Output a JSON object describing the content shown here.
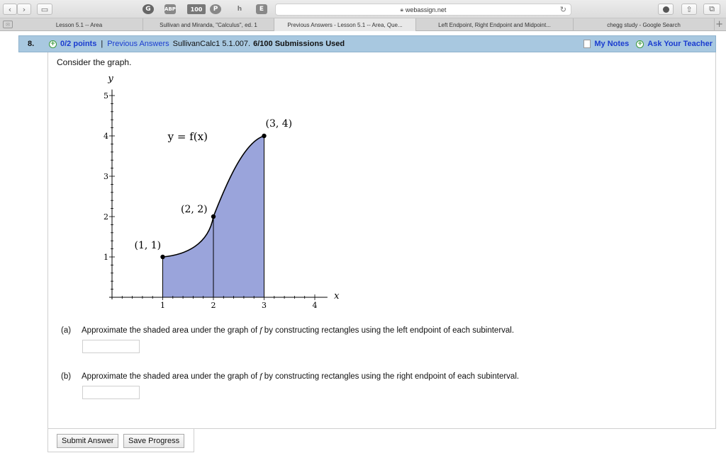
{
  "browser": {
    "url": "webassign.net",
    "extension_badge": "100",
    "tabs": [
      "Lesson 5.1 -- Area",
      "Sullivan and Miranda, \"Calculus\", ed. 1",
      "Previous Answers - Lesson 5.1 -- Area, Que...",
      "Left Endpoint, Right Endpoint and Midpoint...",
      "chegg study - Google Search"
    ]
  },
  "question": {
    "number": "8.",
    "points": "0/2 points",
    "separator": "|",
    "previous_answers": "Previous Answers",
    "source": "SullivanCalc1 5.1.007.",
    "submissions": "6/100 Submissions Used",
    "my_notes": "My Notes",
    "ask_teacher": "Ask Your Teacher",
    "prompt": "Consider the graph."
  },
  "graph": {
    "curve_label": "y = f(x)",
    "axis_x_label": "x",
    "axis_y_label": "y",
    "x_ticks": [
      "1",
      "2",
      "3",
      "4"
    ],
    "y_ticks": [
      "1",
      "2",
      "3",
      "4",
      "5"
    ],
    "points": [
      {
        "label": "(1, 1)",
        "x": 1,
        "y": 1
      },
      {
        "label": "(2, 2)",
        "x": 2,
        "y": 2
      },
      {
        "label": "(3, 4)",
        "x": 3,
        "y": 4
      }
    ],
    "shaded_interval": [
      1,
      3
    ],
    "colors": {
      "fill": "#9aa4db",
      "curve": "#000000"
    }
  },
  "parts": [
    {
      "label": "(a)",
      "before": "Approximate the shaded area under the graph of ",
      "var": "f",
      "after": " by constructing rectangles using the left endpoint of each subinterval.",
      "value": ""
    },
    {
      "label": "(b)",
      "before": "Approximate the shaded area under the graph of ",
      "var": "f",
      "after": " by constructing rectangles using the right endpoint of each subinterval.",
      "value": ""
    }
  ],
  "buttons": {
    "submit": "Submit Answer",
    "save": "Save Progress"
  }
}
